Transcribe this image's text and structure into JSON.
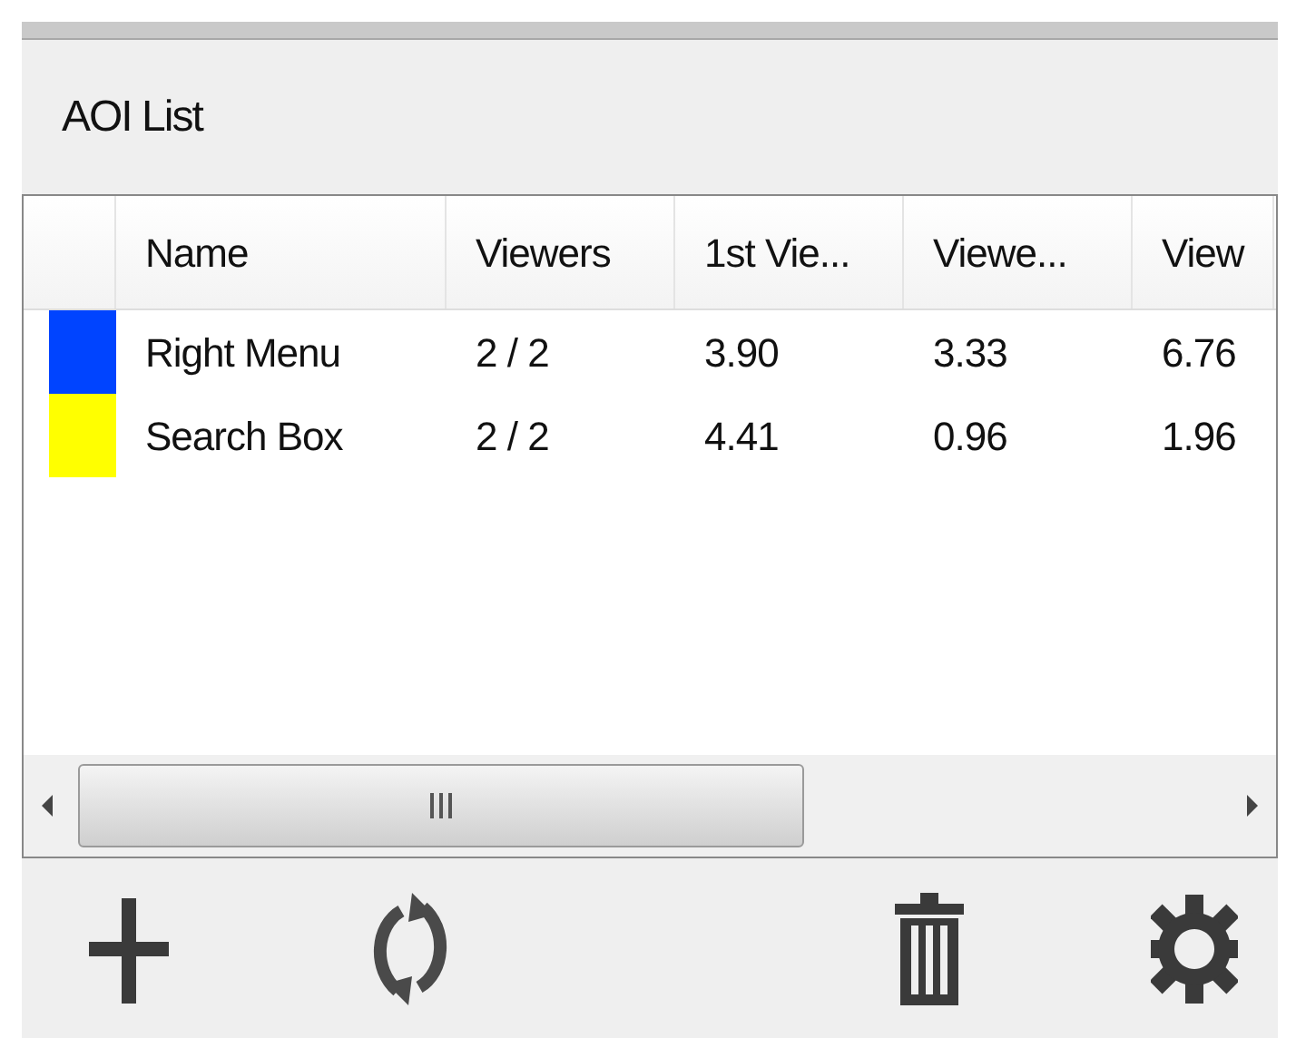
{
  "panel": {
    "title": "AOI List"
  },
  "table": {
    "columns": [
      "Name",
      "Viewers",
      "1st Vie...",
      "Viewe...",
      "View"
    ],
    "rows": [
      {
        "color": "#0044ff",
        "cells": [
          "Right Menu",
          "2 / 2",
          "3.90",
          "3.33",
          "6.76"
        ]
      },
      {
        "color": "#ffff00",
        "cells": [
          "Search Box",
          "2 / 2",
          "4.41",
          "0.96",
          "1.96"
        ]
      }
    ]
  }
}
